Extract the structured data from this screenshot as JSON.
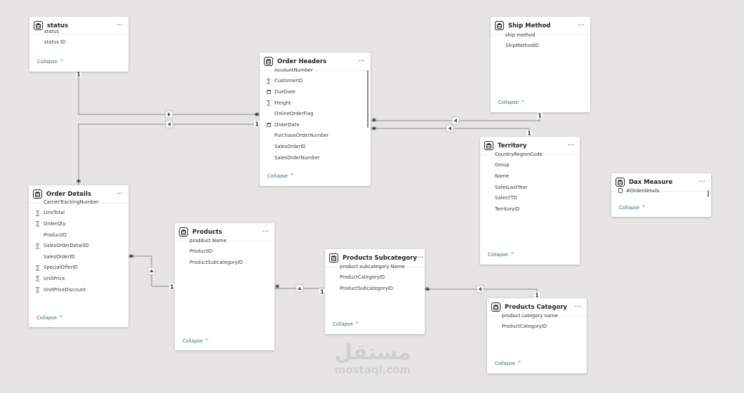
{
  "tables": [
    {
      "id": "status",
      "title": "status",
      "collapse": "Collapse",
      "fields": [
        {
          "name": "status",
          "icon": ""
        },
        {
          "name": "status ID",
          "icon": ""
        }
      ]
    },
    {
      "id": "order-headers",
      "title": "Order Headers",
      "collapse": "Collapse",
      "fields": [
        {
          "name": "AccountNumber",
          "icon": ""
        },
        {
          "name": "CustomerID",
          "icon": "sum"
        },
        {
          "name": "DueDate",
          "icon": "calendar"
        },
        {
          "name": "Freight",
          "icon": "sum"
        },
        {
          "name": "OnlineOrderFlag",
          "icon": ""
        },
        {
          "name": "OrderDate",
          "icon": "calendar"
        },
        {
          "name": "PurchaseOrderNumber",
          "icon": ""
        },
        {
          "name": "SalesOrderID",
          "icon": ""
        },
        {
          "name": "SalesOrderNumber",
          "icon": ""
        }
      ]
    },
    {
      "id": "ship-method",
      "title": "Ship Method",
      "collapse": "Collapse",
      "fields": [
        {
          "name": "ship method",
          "icon": ""
        },
        {
          "name": "ShipMethodID",
          "icon": ""
        }
      ]
    },
    {
      "id": "territory",
      "title": "Territory",
      "collapse": "Collapse",
      "fields": [
        {
          "name": "CountryRegionCode",
          "icon": ""
        },
        {
          "name": "Group",
          "icon": ""
        },
        {
          "name": "Name",
          "icon": ""
        },
        {
          "name": "SalesLastYear",
          "icon": ""
        },
        {
          "name": "SalesYTD",
          "icon": ""
        },
        {
          "name": "TerritoryID",
          "icon": ""
        }
      ]
    },
    {
      "id": "dax-measure",
      "title": "Dax Measure",
      "collapse": "Collapse",
      "fields": [
        {
          "name": "#Orderdetails",
          "icon": "calculator"
        }
      ]
    },
    {
      "id": "order-details",
      "title": "Order Details",
      "collapse": "Collapse",
      "fields": [
        {
          "name": "CarrierTrackingNumber",
          "icon": ""
        },
        {
          "name": "LineTotal",
          "icon": "sum"
        },
        {
          "name": "OrderQty",
          "icon": "sum"
        },
        {
          "name": "ProductID",
          "icon": ""
        },
        {
          "name": "SalesOrderDetailID",
          "icon": "sum"
        },
        {
          "name": "SalesOrderID",
          "icon": ""
        },
        {
          "name": "SpecialOfferID",
          "icon": "sum"
        },
        {
          "name": "UnitPrice",
          "icon": "sum"
        },
        {
          "name": "UnitPriceDiscount",
          "icon": "sum"
        }
      ]
    },
    {
      "id": "products",
      "title": "Products",
      "collapse": "Collapse",
      "fields": [
        {
          "name": "prodduct Name",
          "icon": ""
        },
        {
          "name": "ProductID",
          "icon": ""
        },
        {
          "name": "ProductSubcategoryID",
          "icon": ""
        }
      ]
    },
    {
      "id": "products-subcategory",
      "title": "Products Subcategory",
      "collapse": "Collapse",
      "fields": [
        {
          "name": "product subcategory Name",
          "icon": ""
        },
        {
          "name": "ProductCategoryID",
          "icon": ""
        },
        {
          "name": "ProductSubcategoryID",
          "icon": ""
        }
      ]
    },
    {
      "id": "products-category",
      "title": "Products Category",
      "collapse": "Collapse",
      "fields": [
        {
          "name": "product category name",
          "icon": ""
        },
        {
          "name": "ProductCategoryID",
          "icon": ""
        }
      ]
    }
  ],
  "cardinality": {
    "one": "1",
    "many": "*"
  },
  "icons": {
    "table": "table-icon",
    "more": "more-options-icon",
    "sum": "sigma-icon",
    "calendar": "calendar-icon",
    "calculator": "calculator-icon",
    "collapse": "chevron-up-icon",
    "filter": "filter-direction-arrow-icon"
  },
  "colors": {
    "background": "#e6e5e4",
    "card": "#ffffff",
    "line": "#9c9c9c",
    "collapse_text": "#2c6e6a",
    "text": "#252423"
  },
  "watermark": {
    "arabic": "مستقل",
    "latin": "mostaql.com"
  }
}
